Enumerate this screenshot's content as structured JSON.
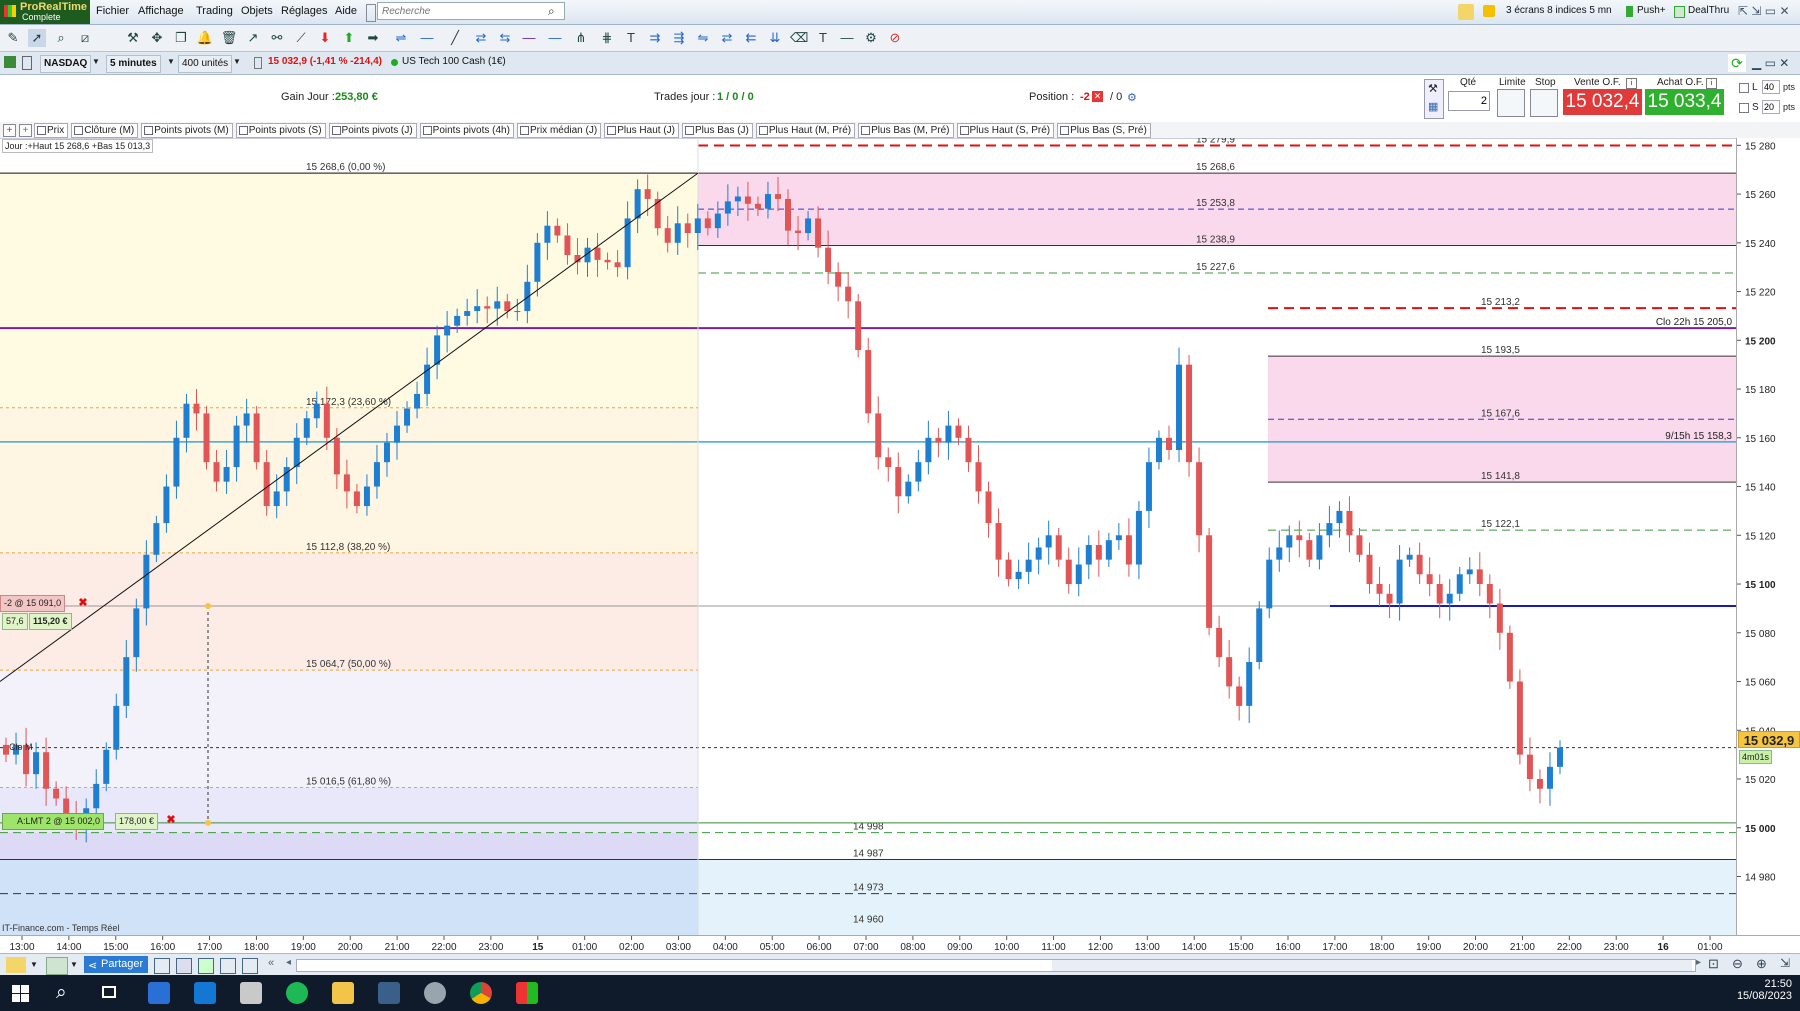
{
  "app": {
    "name": "ProRealTime",
    "edition": "Complete"
  },
  "menu": [
    "Fichier",
    "Affichage",
    "Trading",
    "Objets",
    "Réglages",
    "Aide"
  ],
  "search": {
    "placeholder": "Recherche"
  },
  "topright": {
    "layout": "3 écrans 8 indices 5 mn",
    "push": "Push+",
    "dealthru": "DealThru"
  },
  "instrument": {
    "market": "NASDAQ",
    "timeframe": "5 minutes",
    "units": "400 unités",
    "quote": "15 032,9 (-1,41 % -214,4)",
    "name": "US Tech 100 Cash (1€)"
  },
  "stats": {
    "gain_label": "Gain Jour :",
    "gain_value": "253,80 €",
    "trades_label": "Trades jour :",
    "trades_value": "1 / 0 / 0",
    "position_label": "Position :",
    "position_value": "-2",
    "position_extra": "/ 0"
  },
  "order": {
    "qty_label": "Qté",
    "qty_value": "2",
    "limit_label": "Limite",
    "stop_label": "Stop",
    "sell_label": "Vente O.F.",
    "sell_price": "15 032,4",
    "buy_label": "Achat O.F.",
    "buy_price": "15 033,4",
    "l_label": "L",
    "l_value": "40",
    "s_label": "S",
    "s_value": "20",
    "pts": "pts"
  },
  "indicators": [
    "Prix",
    "Clôture (M)",
    "Points pivots (M)",
    "Points pivots (S)",
    "Points pivots (J)",
    "Points pivots (4h)",
    "Prix médian (J)",
    "Plus Haut (J)",
    "Plus Bas (J)",
    "Plus Haut (M, Pré)",
    "Plus Bas (M, Pré)",
    "Plus Haut (S, Pré)",
    "Plus Bas (S, Pré)"
  ],
  "chart_data": {
    "type": "candlestick",
    "info": "Jour :+Haut 15 268,6 +Bas 15 013,3",
    "source": "IT-Finance.com - Temps Réel",
    "y_ticks": [
      15280,
      15260,
      15240,
      15220,
      15200,
      15180,
      15160,
      15140,
      15120,
      15100,
      15080,
      15060,
      15040,
      15020,
      15000,
      14980
    ],
    "y_tick_labels": [
      "15 280",
      "15 260",
      "15 240",
      "15 220",
      "15 200",
      "15 180",
      "15 160",
      "15 140",
      "15 120",
      "15 100",
      "15 080",
      "15 060",
      "15 040",
      "15 020",
      "15 000",
      "14 980"
    ],
    "bold_ticks": [
      15200,
      15100,
      15000
    ],
    "ylim": [
      14956,
      15283
    ],
    "x_ticks": [
      "13:00",
      "14:00",
      "15:00",
      "16:00",
      "17:00",
      "18:00",
      "19:00",
      "20:00",
      "21:00",
      "22:00",
      "23:00",
      "15",
      "01:00",
      "02:00",
      "03:00",
      "04:00",
      "05:00",
      "06:00",
      "07:00",
      "08:00",
      "09:00",
      "10:00",
      "11:00",
      "12:00",
      "13:00",
      "14:00",
      "15:00",
      "16:00",
      "17:00",
      "18:00",
      "19:00",
      "20:00",
      "21:00",
      "22:00",
      "23:00",
      "16",
      "01:00"
    ],
    "bold_x_ticks": [
      "15",
      "16"
    ],
    "fib_levels": [
      {
        "label": "15 268,6 (0,00 %)",
        "value": 15268.6
      },
      {
        "label": "15 172,3 (23,60 %)",
        "value": 15172.3
      },
      {
        "label": "15 112,8 (38,20 %)",
        "value": 15112.8
      },
      {
        "label": "15 064,7 (50,00 %)",
        "value": 15064.7
      },
      {
        "label": "15 016,5 (61,80 %)",
        "value": 15016.5
      }
    ],
    "level_labels": [
      {
        "label": "15 279,9",
        "value": 15279.9
      },
      {
        "label": "15 268,6",
        "value": 15268.6
      },
      {
        "label": "15 253,8",
        "value": 15253.8
      },
      {
        "label": "15 238,9",
        "value": 15238.9
      },
      {
        "label": "15 227,6",
        "value": 15227.6
      },
      {
        "label": "15 213,2",
        "value": 15213.2
      },
      {
        "label": "15 193,5",
        "value": 15193.5
      },
      {
        "label": "15 167,6",
        "value": 15167.6
      },
      {
        "label": "15 141,8",
        "value": 15141.8
      },
      {
        "label": "15 122,1",
        "value": 15122.1
      },
      {
        "label": "14 998",
        "value": 14998
      },
      {
        "label": "14 987",
        "value": 14987
      },
      {
        "label": "14 973",
        "value": 14973
      },
      {
        "label": "14 960",
        "value": 14960
      }
    ],
    "right_labels": [
      {
        "label": "Clo 22h 15 205,0",
        "value": 15205.0
      },
      {
        "label": "9/15h 15 158,3",
        "value": 15158.3
      }
    ],
    "clo_m_label": "Clo M",
    "current_price": {
      "label": "15 032,9",
      "value": 15032.9,
      "countdown": "4m01s"
    },
    "order_markers": {
      "position": "-2 @ 15 091,0",
      "p1": "57,6",
      "p2": "115,20 €",
      "limit": "A:LMT 2 @ 15 002,0",
      "limit_value": "178,00 €"
    },
    "close_series": [
      15030,
      15034,
      15022,
      15031,
      15016,
      15012,
      15004,
      15000,
      15008,
      15018,
      15032,
      15050,
      15070,
      15090,
      15112,
      15125,
      15140,
      15160,
      15174,
      15170,
      15150,
      15142,
      15148,
      15165,
      15170,
      15150,
      15132,
      15138,
      15148,
      15160,
      15168,
      15174,
      15160,
      15145,
      15138,
      15132,
      15140,
      15150,
      15158,
      15165,
      15172,
      15178,
      15190,
      15202,
      15206,
      15210,
      15212,
      15214,
      15213,
      15216,
      15212,
      15212,
      15224,
      15240,
      15247,
      15243,
      15235,
      15232,
      15238,
      15233,
      15232,
      15230,
      15250,
      15262,
      15258,
      15246,
      15240,
      15248,
      15244,
      15250,
      15246,
      15252,
      15257,
      15259,
      15256,
      15254,
      15260,
      15258,
      15245,
      15244,
      15250,
      15238,
      15228,
      15222,
      15216,
      15196,
      15170,
      15152,
      15148,
      15136,
      15142,
      15150,
      15160,
      15158,
      15165,
      15160,
      15150,
      15138,
      15125,
      15110,
      15102,
      15105,
      15110,
      15115,
      15120,
      15110,
      15100,
      15108,
      15116,
      15110,
      15118,
      15120,
      15108,
      15130,
      15150,
      15160,
      15155,
      15190,
      15150,
      15120,
      15082,
      15070,
      15058,
      15050,
      15068,
      15090,
      15110,
      15115,
      15120,
      15118,
      15110,
      15120,
      15125,
      15130,
      15120,
      15112,
      15100,
      15096,
      15092,
      15110,
      15112,
      15104,
      15100,
      15092,
      15096,
      15104,
      15106,
      15100,
      15092,
      15080,
      15060,
      15030,
      15020,
      15016,
      15025,
      15032.9
    ]
  },
  "bottom": {
    "share_label": "Partager"
  },
  "taskbar": {
    "time": "21:50",
    "date": "15/08/2023"
  }
}
